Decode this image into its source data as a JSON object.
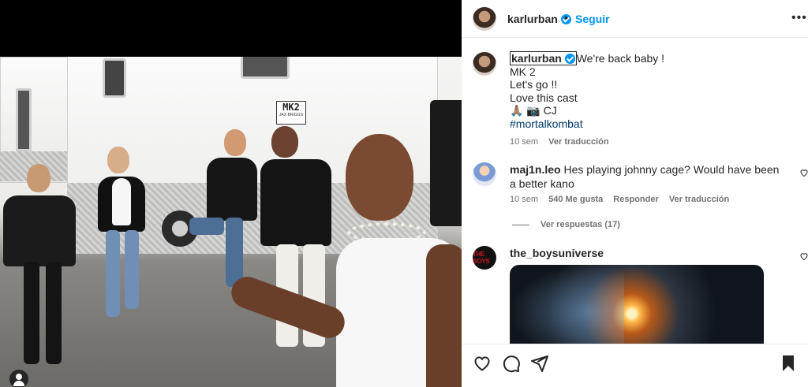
{
  "post": {
    "username": "karlurban",
    "follow_label": "Seguir",
    "separator": "•",
    "more_label": "•••",
    "caption": {
      "username": "karlurban",
      "lines": [
        "We're back baby !",
        "MK 2",
        "Let's go !!",
        "Love this cast",
        "🙏🏽 📷 CJ",
        "#mortalkombat"
      ],
      "time": "10 sem",
      "translate_label": "Ver traducción"
    },
    "photo_signs": {
      "sign_big": "MK2",
      "sign_small": "JAX BRIGGS"
    }
  },
  "comments": [
    {
      "username": "maj1n.leo",
      "text": "Hes playing johnny cage? Would have been a better kano",
      "time": "10 sem",
      "likes": "540 Me gusta",
      "reply_label": "Responder",
      "translate_label": "Ver traducción",
      "view_replies": "Ver respuestas (17)"
    },
    {
      "username": "the_boysuniverse",
      "avatar_text": "THE BOYS"
    }
  ],
  "icons": {
    "like": "heart-icon",
    "comment": "comment-icon",
    "share": "share-icon",
    "save": "bookmark-icon"
  },
  "colors": {
    "accent": "#0095f6",
    "verified": "#0095f6",
    "hashtag": "#00376b"
  }
}
